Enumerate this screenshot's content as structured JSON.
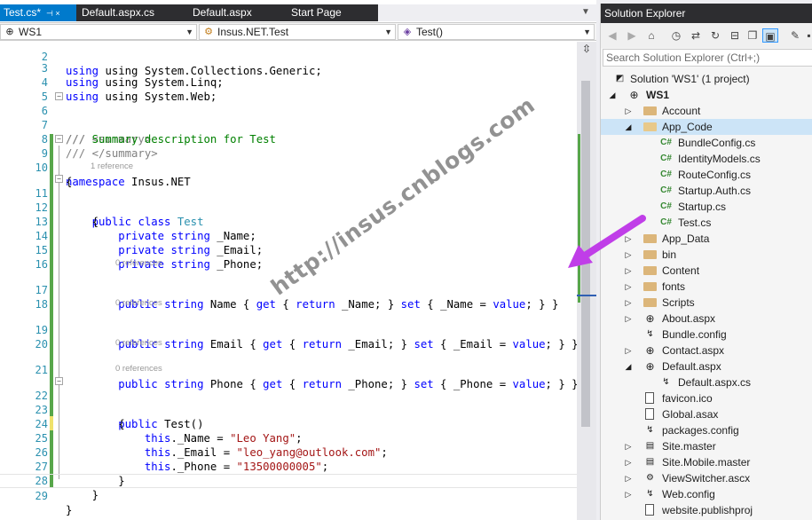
{
  "tabs": [
    {
      "label": "Test.cs*",
      "pin": "⊣ ×",
      "active": true
    },
    {
      "label": "Default.aspx.cs",
      "active": false
    },
    {
      "label": "Default.aspx",
      "active": false
    },
    {
      "label": "Start Page",
      "active": false
    }
  ],
  "nav_bar": {
    "project": "WS1",
    "class": "Insus.NET.Test",
    "member": "Test()"
  },
  "code_lines": {
    "l2": "using System.Collections.Generic;",
    "l3": "using System.Linq;",
    "l4": "using System.Web;",
    "l6": "/// <summary>",
    "l7": "Summary description for Test",
    "l8": "/// </summary>",
    "l9_kw": "namespace",
    "l9": " Insus.NET",
    "l10": "{",
    "lens_class": "1 reference",
    "l11_kw": "public class",
    "l11_ty": "Test",
    "l12": "{",
    "l13": "_Name;",
    "l14": "_Email;",
    "l15": "_Phone;",
    "lens_ref0": "0 references",
    "l17": "Name",
    "l17_body": " _Name; } ",
    "l17_set": " _Name = ",
    "l19": "Email",
    "l19_body": " _Email; } ",
    "l19_set": " _Email = ",
    "l21": "Phone",
    "l21_body": " _Phone; } ",
    "l21_set": " _Phone = ",
    "l22": "Test()",
    "l23": "{",
    "l24": "._Name = ",
    "l24_str": "\"Leo Yang\"",
    "l25": "._Email = ",
    "l25_str": "\"leo_yang@outlook.com\"",
    "l26": "._Phone = ",
    "l26_str": "\"13500000005\"",
    "l27": "}",
    "l28": "}",
    "l29": "}",
    "kw_private": "private",
    "kw_string": "string",
    "kw_public": "public",
    "kw_get": "get",
    "kw_return": "return",
    "kw_set": "set",
    "kw_value": "value",
    "kw_this": "this",
    "kw_using": "using",
    "cm_prefix": "/// "
  },
  "line_numbers": [
    "2",
    "3",
    "4",
    "5",
    "6",
    "7",
    "8",
    "9",
    "10",
    "11",
    "12",
    "13",
    "14",
    "15",
    "16",
    "17",
    "18",
    "19",
    "20",
    "21",
    "22",
    "23",
    "24",
    "25",
    "26",
    "27",
    "28",
    "29"
  ],
  "solution_explorer": {
    "title": "Solution Explorer",
    "search_placeholder": "Search Solution Explorer (Ctrl+;)",
    "solution": "Solution 'WS1' (1 project)",
    "project": "WS1",
    "items": {
      "account": "Account",
      "app_code": "App_Code",
      "bundleconfig": "BundleConfig.cs",
      "identitymodels": "IdentityModels.cs",
      "routeconfig": "RouteConfig.cs",
      "startup_auth": "Startup.Auth.cs",
      "startup": "Startup.cs",
      "test_cs": "Test.cs",
      "app_data": "App_Data",
      "bin": "bin",
      "content": "Content",
      "fonts": "fonts",
      "scripts": "Scripts",
      "about": "About.aspx",
      "bundle_config": "Bundle.config",
      "contact": "Contact.aspx",
      "default": "Default.aspx",
      "default_cs": "Default.aspx.cs",
      "favicon": "favicon.ico",
      "global": "Global.asax",
      "packages": "packages.config",
      "site_master": "Site.master",
      "site_mobile": "Site.Mobile.master",
      "viewswitcher": "ViewSwitcher.ascx",
      "web_config": "Web.config",
      "publishproj": "website.publishproj"
    }
  },
  "watermark": "http://insus.cnblogs.com",
  "colors": {
    "accent": "#007acc",
    "keyword": "#0000ff",
    "type": "#2b91af",
    "string": "#a31515",
    "comment": "#008000",
    "change_saved": "#57a64a",
    "change_unsaved": "#efe26b",
    "arrow": "#c03ee8"
  }
}
